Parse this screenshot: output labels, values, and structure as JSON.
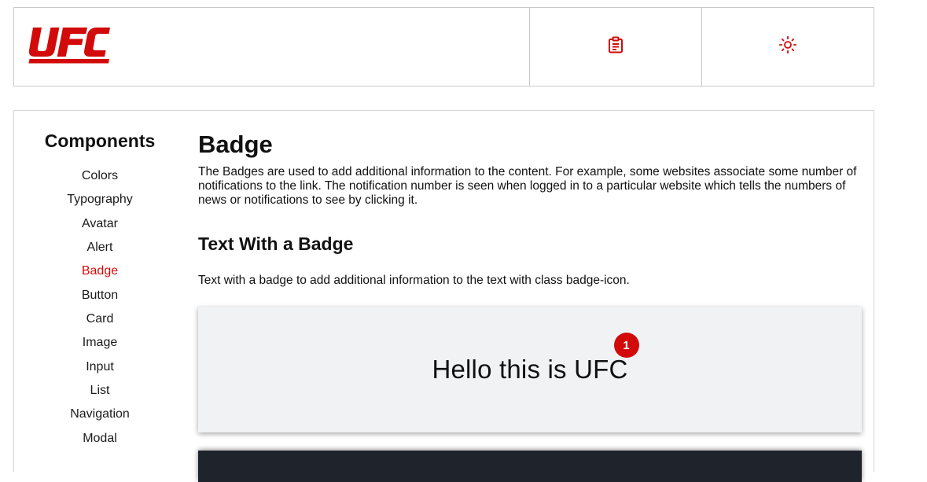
{
  "header": {
    "logo_text": "UFC",
    "actions": [
      {
        "icon": "clipboard-icon"
      },
      {
        "icon": "sun-icon"
      }
    ]
  },
  "colors": {
    "accent": "#d20a0a",
    "demo_background": "#f1f2f4",
    "code_background": "#1f242c"
  },
  "sidebar": {
    "title": "Components",
    "items": [
      {
        "label": "Colors"
      },
      {
        "label": "Typography"
      },
      {
        "label": "Avatar"
      },
      {
        "label": "Alert"
      },
      {
        "label": "Badge",
        "active": true
      },
      {
        "label": "Button"
      },
      {
        "label": "Card"
      },
      {
        "label": "Image"
      },
      {
        "label": "Input"
      },
      {
        "label": "List"
      },
      {
        "label": "Navigation"
      },
      {
        "label": "Modal"
      }
    ]
  },
  "main": {
    "title": "Badge",
    "description": "The Badges are used to add additional information to the content. For example, some websites associate some number of notifications to the link. The notification number is seen when logged in to a particular website which tells the numbers of news or notifications to see by clicking it.",
    "section": {
      "title": "Text With a Badge",
      "description": "Text with a badge to add additional information to the text with class badge-icon.",
      "demo_text": "Hello this is UFC",
      "badge_count": "1"
    }
  }
}
